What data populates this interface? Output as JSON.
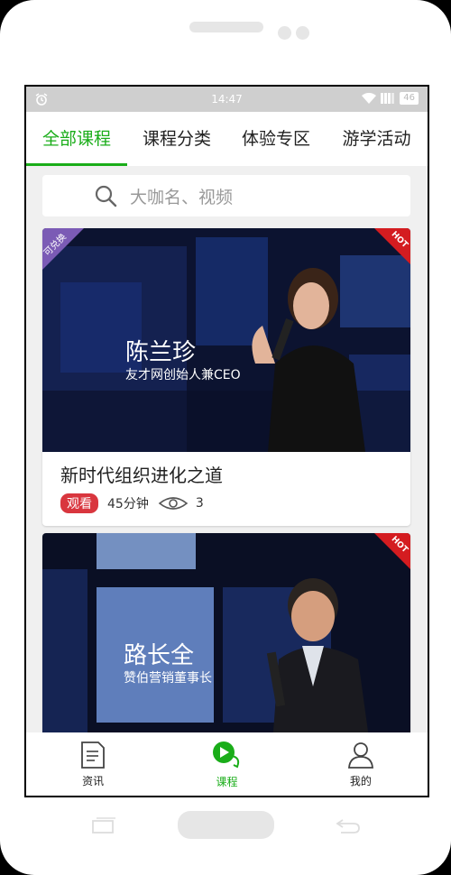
{
  "status": {
    "time": "14:47",
    "battery": "46"
  },
  "tabs": [
    {
      "label": "全部课程",
      "active": true
    },
    {
      "label": "课程分类",
      "active": false
    },
    {
      "label": "体验专区",
      "active": false
    },
    {
      "label": "游学活动",
      "active": false
    }
  ],
  "search": {
    "placeholder": "大咖名、视频"
  },
  "cards": [
    {
      "ribbon_left": "可兑换",
      "ribbon_right": "HOT",
      "speaker_name": "陈兰珍",
      "speaker_title": "友才网创始人兼CEO",
      "title": "新时代组织进化之道",
      "badge": "观看",
      "duration": "45分钟",
      "views": "3"
    },
    {
      "ribbon_right": "HOT",
      "speaker_name": "路长全",
      "speaker_title": "赞伯营销董事长"
    }
  ],
  "bottom_nav": [
    {
      "label": "资讯",
      "icon": "news-icon",
      "active": false
    },
    {
      "label": "课程",
      "icon": "play-chat-icon",
      "active": true
    },
    {
      "label": "我的",
      "icon": "user-icon",
      "active": false
    }
  ],
  "colors": {
    "accent": "#1aad19",
    "hot": "#d41c20",
    "badge": "#d9363e",
    "exchange": "#7b5bb5"
  }
}
